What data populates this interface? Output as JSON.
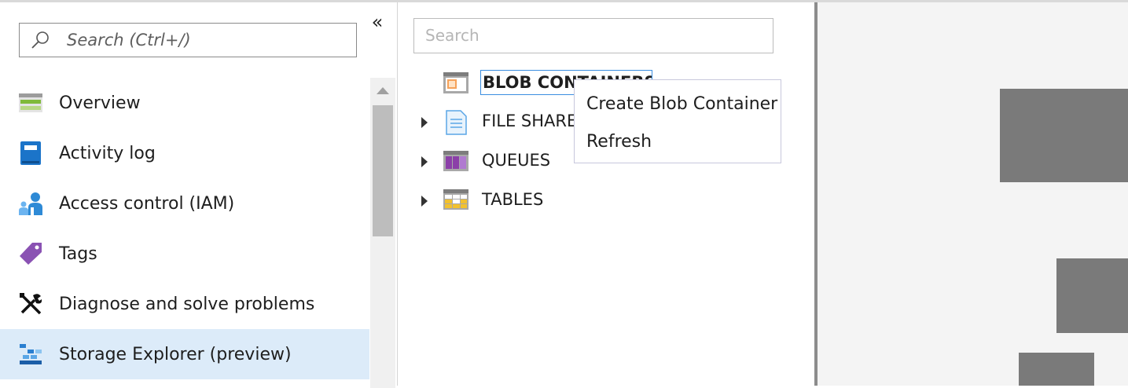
{
  "nav": {
    "search_placeholder": "Search (Ctrl+/)",
    "collapse_glyph": "«",
    "items": [
      {
        "label": "Overview",
        "icon": "overview-icon"
      },
      {
        "label": "Activity log",
        "icon": "activity-log-icon"
      },
      {
        "label": "Access control (IAM)",
        "icon": "access-control-icon"
      },
      {
        "label": "Tags",
        "icon": "tag-icon"
      },
      {
        "label": "Diagnose and solve problems",
        "icon": "wrench-icon"
      },
      {
        "label": "Storage Explorer (preview)",
        "icon": "storage-explorer-icon",
        "selected": true
      }
    ]
  },
  "explorer": {
    "search_placeholder": "Search",
    "tree": [
      {
        "label": "BLOB CONTAINERS",
        "icon": "blob-container-icon",
        "selected": true,
        "expandable": false
      },
      {
        "label": "FILE SHARES",
        "icon": "file-share-icon",
        "expandable": true
      },
      {
        "label": "QUEUES",
        "icon": "queue-icon",
        "expandable": true
      },
      {
        "label": "TABLES",
        "icon": "table-icon",
        "expandable": true
      }
    ]
  },
  "context_menu": {
    "items": [
      "Create Blob Container",
      "Refresh"
    ]
  },
  "colors": {
    "selected_bg": "#dcebf9",
    "focus_border": "#3b8ee0",
    "placeholder_block": "#7a7a7a"
  }
}
